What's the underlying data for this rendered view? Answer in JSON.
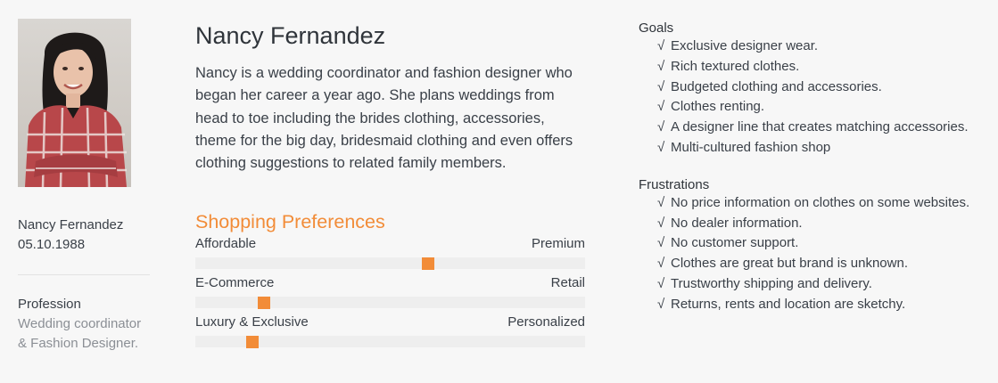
{
  "profile": {
    "name": "Nancy Fernandez",
    "dob": "05.10.1988",
    "profession_label": "Profession",
    "profession_value": "Wedding coordinator & Fashion Designer.",
    "photo_icon": "person-photo"
  },
  "main": {
    "title": "Nancy Fernandez",
    "bio": "Nancy is a wedding coordinator and fashion designer who began her career a year ago. She plans weddings from head to toe including the brides clothing, accessories, theme for the big day, bridesmaid clothing and even offers clothing suggestions to related family members."
  },
  "preferences": {
    "title": "Shopping Preferences",
    "accent": "#f28c38",
    "items": [
      {
        "left": "Affordable",
        "right": "Premium",
        "level": 0.6
      },
      {
        "left": "E-Commerce",
        "right": "Retail",
        "level": 0.165
      },
      {
        "left": "Luxury & Exclusive",
        "right": "Personalized",
        "level": 0.135
      }
    ]
  },
  "goals": {
    "title": "Goals",
    "check_symbol": "√",
    "items": [
      "Exclusive designer wear.",
      "Rich textured clothes.",
      "Budgeted clothing and accessories.",
      "Clothes renting.",
      "A designer line that creates matching accessories.",
      "Multi-cultured fashion shop"
    ]
  },
  "frustrations": {
    "title": "Frustrations",
    "check_symbol": "√",
    "items": [
      "No price information on clothes on some websites.",
      "No dealer information.",
      "No customer support.",
      "Clothes are great but brand is unknown.",
      "Trustworthy shipping and delivery.",
      "Returns, rents and location are sketchy."
    ]
  }
}
